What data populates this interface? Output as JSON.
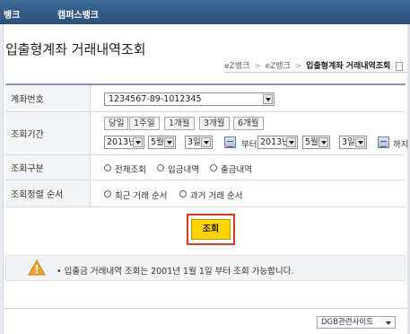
{
  "topbar": {
    "left_text": "뱅크",
    "right_text": "캠퍼스뱅크"
  },
  "page": {
    "title": "입출형계좌 거래내역조회"
  },
  "breadcrumb": {
    "items": [
      "eZ뱅크",
      "eZ뱅크"
    ],
    "separator": ">",
    "current": "입출형계좌 거래내역조회"
  },
  "form": {
    "account": {
      "label": "계좌번호",
      "value": "1234567-89-1012345"
    },
    "period": {
      "label": "조회기간",
      "quick_buttons": [
        "당일",
        "1주일",
        "1개월",
        "3개월",
        "6개월"
      ],
      "from": {
        "year": "2013년",
        "month": "5월",
        "day": "3일"
      },
      "to": {
        "year": "2013년",
        "month": "5월",
        "day": "3일"
      },
      "from_suffix": "부터",
      "to_suffix": "까지"
    },
    "type": {
      "label": "조회구분",
      "options": [
        "전체조회",
        "입금내역",
        "출금내역"
      ]
    },
    "order": {
      "label": "조회정렬 순서",
      "options": [
        "최근 거래 순서",
        "과거 거래 순서"
      ]
    }
  },
  "search_button": {
    "label": "조회"
  },
  "notice": {
    "text": "• 입출금 거래내역 조회는 2001년 1월 1일 부터 조회 가능합니다."
  },
  "footer": {
    "site_select": "DGB관련사이트"
  },
  "colors": {
    "topbar": "#2f5580",
    "search_button": "#ffd400",
    "highlight_border": "#d23c24",
    "warning": "#f0a030"
  }
}
